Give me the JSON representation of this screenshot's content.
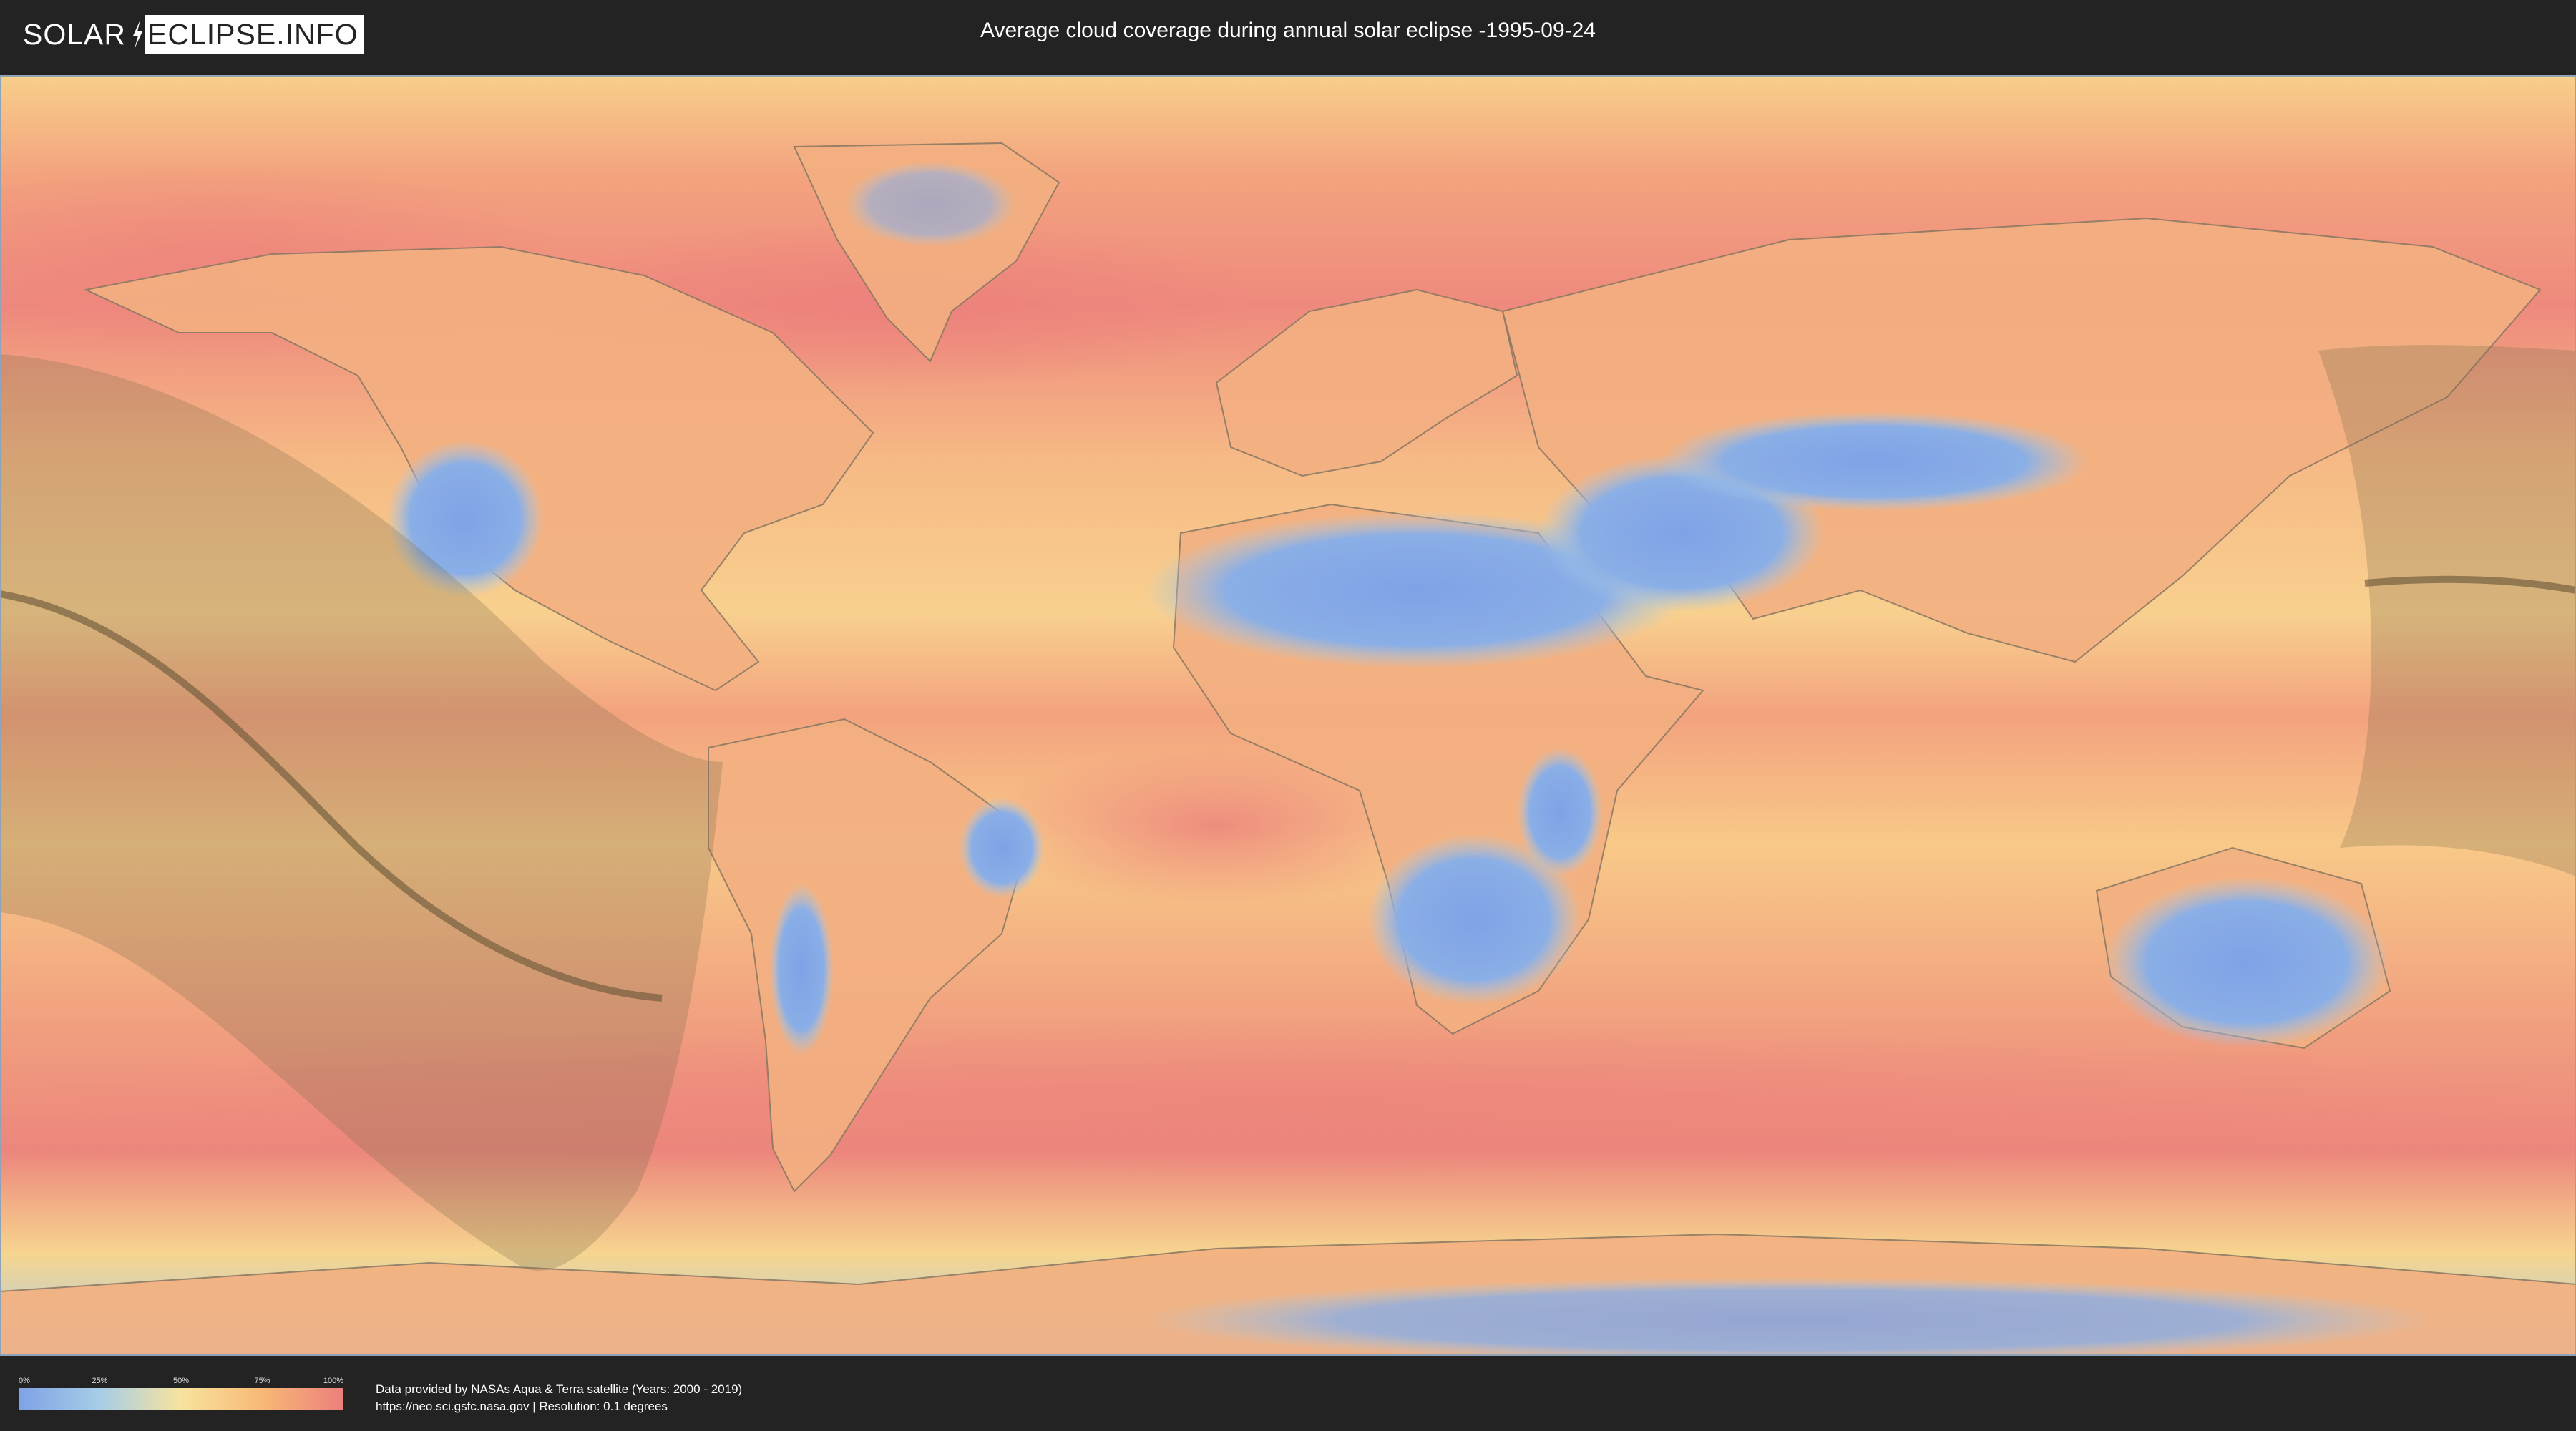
{
  "header": {
    "logo_part1": "SOLAR",
    "logo_part2": "ECLIPSE.INFO",
    "title": "Average cloud coverage during annual solar eclipse -1995-09-24"
  },
  "legend": {
    "ticks": [
      "0%",
      "25%",
      "50%",
      "75%",
      "100%"
    ],
    "colors": [
      "#7fa2e6",
      "#a7cde6",
      "#f7e39e",
      "#f8b876",
      "#ec7f7c"
    ]
  },
  "credits": {
    "line1": "Data provided by NASAs Aqua & Terra satellite (Years: 2000 - 2019)",
    "line2": "https://neo.sci.gsfc.nasa.gov | Resolution: 0.1 degrees"
  },
  "map": {
    "colors": {
      "ocean_base": "#f4a27a",
      "high_cloud": "#ec7f7c",
      "mid_cloud": "#f8c98a",
      "low_cloud": "#7fa2e6",
      "eclipse_shadow": "#7c6a4a",
      "central_line": "#6f5a3c"
    }
  }
}
